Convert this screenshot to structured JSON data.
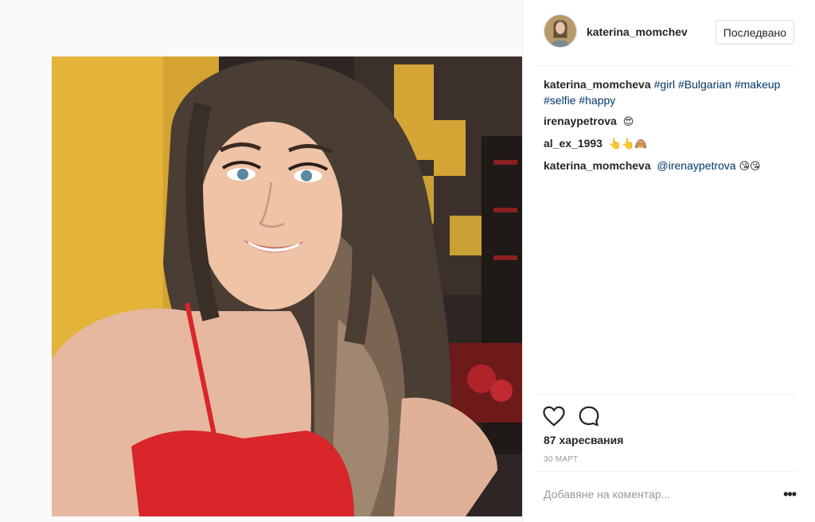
{
  "post": {
    "author": "katerina_momchev",
    "follow_label": "Последвано",
    "likes_text": "87 харесвания",
    "date": "30 МАРТ",
    "comment_placeholder": "Добавяне на коментар...",
    "more_label": "•••"
  },
  "caption": {
    "author": "katerina_momcheva",
    "tags": [
      "#girl",
      "#Bulgarian",
      "#makeup",
      "#selfie",
      "#happy"
    ]
  },
  "comments": [
    {
      "author": "irenaypetrova",
      "mention": "",
      "text": "😍"
    },
    {
      "author": "al_ex_1993",
      "mention": "",
      "text": "👆👆🙈"
    },
    {
      "author": "katerina_momcheva",
      "mention": "@irenaypetrova",
      "text": "😘😘"
    }
  ],
  "icons": {
    "like": "heart-icon",
    "comment": "speech-bubble-icon",
    "more": "more-options-icon"
  },
  "colors": {
    "link": "#003569",
    "border": "#efefef",
    "top_red": "#d8262a",
    "wall_yellow": "#e5b83a"
  }
}
